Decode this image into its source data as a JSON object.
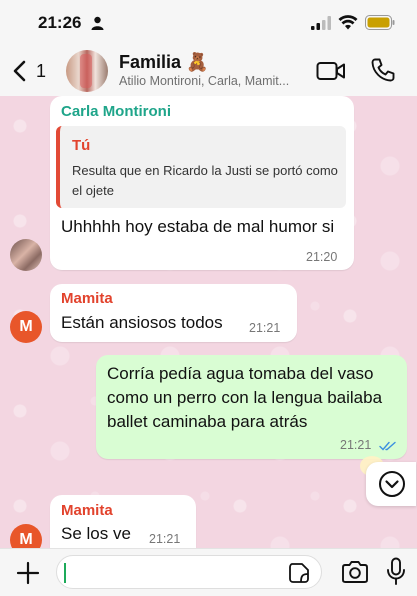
{
  "status_bar": {
    "time": "21:26"
  },
  "header": {
    "back_count": "1",
    "title": "Familia 🧸",
    "subtitle": "Atilio Montironi, Carla, Mamit..."
  },
  "messages": [
    {
      "sender": "Carla Montironi",
      "quote_author": "Tú",
      "quote_text": "Resulta que en Ricardo la Justi se portó como el ojete",
      "text": "Uhhhhh hoy estaba de mal humor si",
      "time": "21:20"
    },
    {
      "sender": "Mamita",
      "avatar_letter": "M",
      "text": "Están ansiosos todos",
      "time": "21:21"
    },
    {
      "direction": "outgoing",
      "text": "Corría pedía agua tomaba del vaso como un perro con la lengua bailaba ballet caminaba para atrás",
      "time": "21:21",
      "status": "read"
    },
    {
      "sender": "Mamita",
      "avatar_letter": "M",
      "text": "Se los ve",
      "time": "21:21"
    }
  ],
  "input": {
    "placeholder": ""
  },
  "colors": {
    "chat_background": "#f3d6e1",
    "outgoing_bubble": "#d9fdd3",
    "carla_name": "#1fa58a",
    "mamita_name": "#e2432d",
    "read_ticks": "#3b8fe0"
  }
}
